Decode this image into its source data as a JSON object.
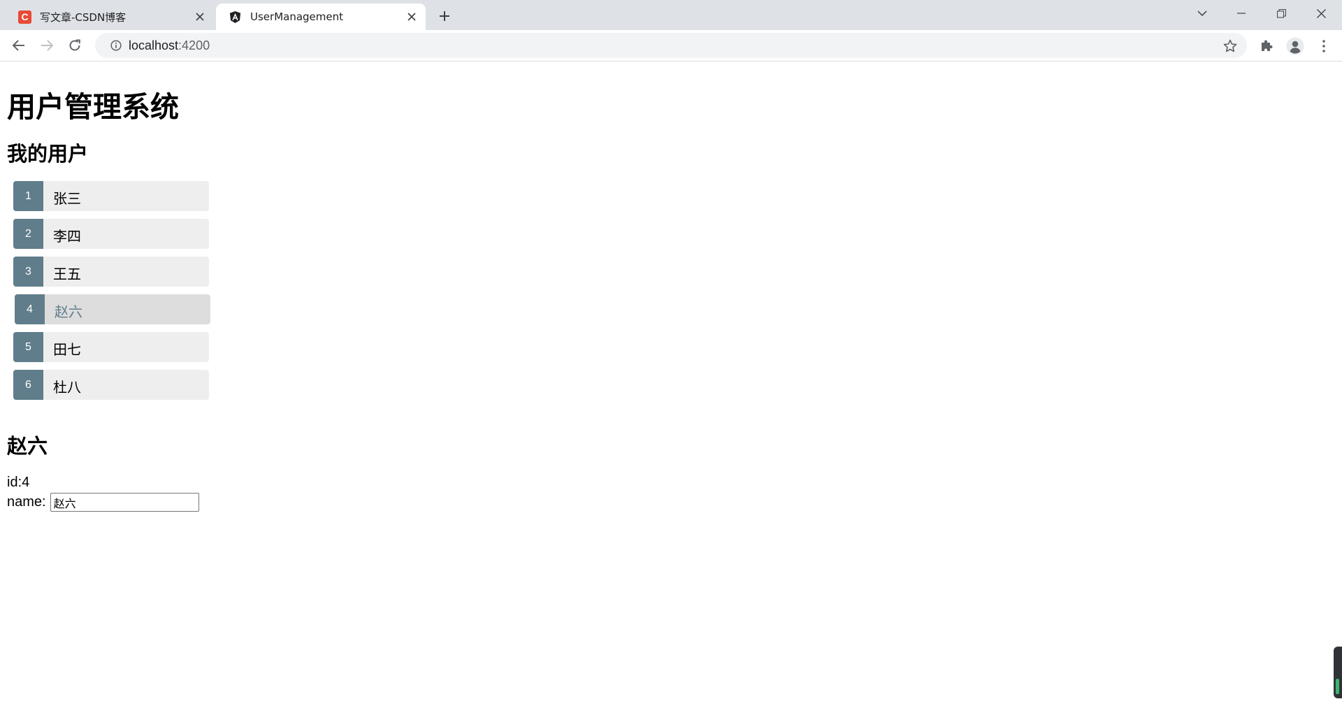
{
  "browser": {
    "tabs": [
      {
        "title": "写文章-CSDN博客",
        "favicon_letter": "C",
        "active": false
      },
      {
        "title": "UserManagement",
        "favicon_letter": "A",
        "active": true
      }
    ],
    "url_host": "localhost",
    "url_port": ":4200"
  },
  "page": {
    "title": "用户管理系统",
    "section_title": "我的用户",
    "users": [
      {
        "id": "1",
        "name": "张三"
      },
      {
        "id": "2",
        "name": "李四"
      },
      {
        "id": "3",
        "name": "王五"
      },
      {
        "id": "4",
        "name": "赵六"
      },
      {
        "id": "5",
        "name": "田七"
      },
      {
        "id": "6",
        "name": "杜八"
      }
    ],
    "selected_user_index": 3,
    "detail": {
      "title": "赵六",
      "id_text": "id:4",
      "name_label": "name:",
      "name_value": "赵六"
    }
  },
  "colors": {
    "badge": "#607d8b",
    "item_bg": "#eeeeee",
    "selected_bg": "#dddddd",
    "tabstrip": "#dee1e6"
  }
}
